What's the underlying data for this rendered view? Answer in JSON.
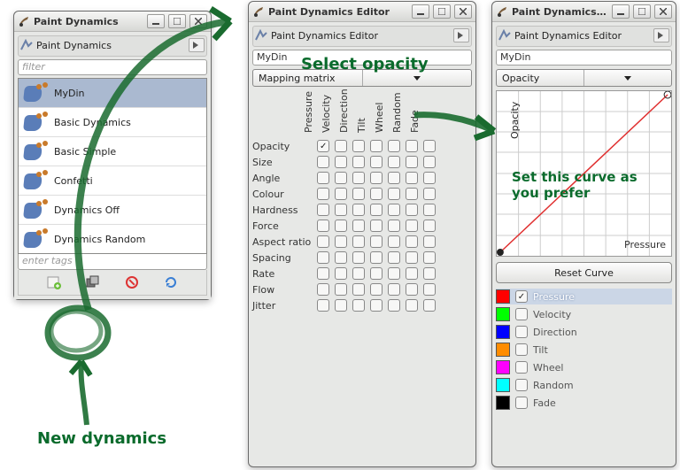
{
  "win1": {
    "title": "Paint Dynamics",
    "panel_header": "Paint Dynamics",
    "filter_placeholder": "filter",
    "tags_placeholder": "enter tags",
    "items": [
      {
        "label": "MyDin",
        "selected": true
      },
      {
        "label": "Basic Dynamics",
        "selected": false
      },
      {
        "label": "Basic Simple",
        "selected": false
      },
      {
        "label": "Confetti",
        "selected": false
      },
      {
        "label": "Dynamics Off",
        "selected": false
      },
      {
        "label": "Dynamics Random",
        "selected": false
      }
    ],
    "toolbar_icons": [
      "new-dynamics-icon",
      "duplicate-icon",
      "delete-icon",
      "refresh-icon"
    ]
  },
  "win2": {
    "title": "Paint Dynamics Editor",
    "panel_header": "Paint Dynamics Editor",
    "name_value": "MyDin",
    "combo_label": "Mapping matrix",
    "columns": [
      "Pressure",
      "Velocity",
      "Direction",
      "Tilt",
      "Wheel",
      "Random",
      "Fade"
    ],
    "rows": [
      "Opacity",
      "Size",
      "Angle",
      "Colour",
      "Hardness",
      "Force",
      "Aspect ratio",
      "Spacing",
      "Rate",
      "Flow",
      "Jitter"
    ],
    "checked": {
      "Opacity": {
        "Pressure": true
      }
    }
  },
  "win3": {
    "title": "Paint Dynamics Edito",
    "panel_header": "Paint Dynamics Editor",
    "name_value": "MyDin",
    "combo_label": "Opacity",
    "y_axis_label": "Opacity",
    "x_axis_label": "Pressure",
    "reset_label": "Reset Curve",
    "inputs": [
      {
        "color": "#ff0000",
        "label": "Pressure",
        "checked": true,
        "selected": true
      },
      {
        "color": "#00ff00",
        "label": "Velocity",
        "checked": false,
        "selected": false
      },
      {
        "color": "#0000ff",
        "label": "Direction",
        "checked": false,
        "selected": false
      },
      {
        "color": "#ff8c00",
        "label": "Tilt",
        "checked": false,
        "selected": false
      },
      {
        "color": "#ff00ff",
        "label": "Wheel",
        "checked": false,
        "selected": false
      },
      {
        "color": "#00ffff",
        "label": "Random",
        "checked": false,
        "selected": false
      },
      {
        "color": "#000000",
        "label": "Fade",
        "checked": false,
        "selected": false
      }
    ]
  },
  "annotations": {
    "new_dynamics": "New dynamics",
    "select_opacity": "Select opacity",
    "set_curve_l1": "Set this curve as",
    "set_curve_l2": "you prefer"
  }
}
